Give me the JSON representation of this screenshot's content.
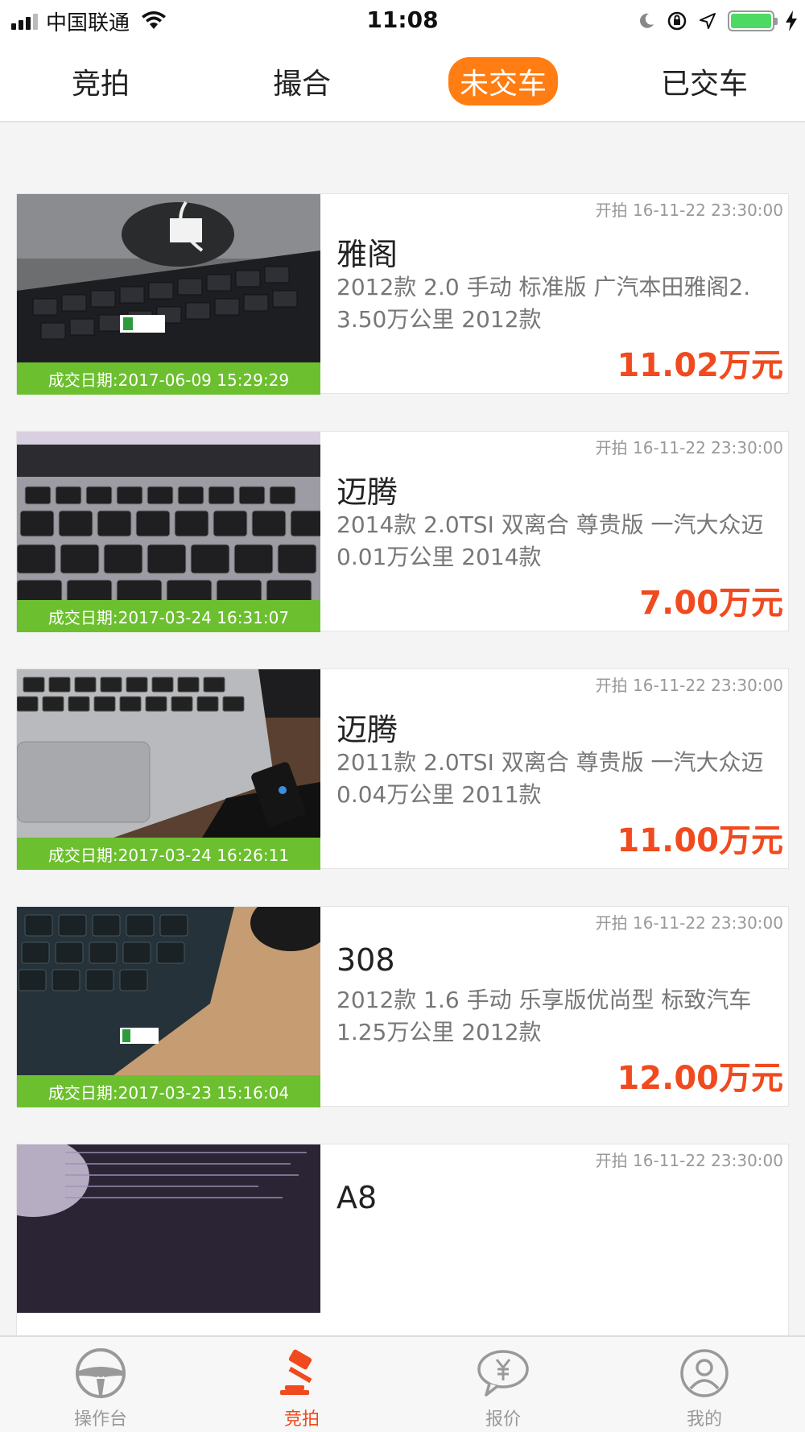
{
  "status_bar": {
    "carrier": "中国联通",
    "time": "11:08"
  },
  "tabs": [
    {
      "label": "竞拍",
      "active": false
    },
    {
      "label": "撮合",
      "active": false
    },
    {
      "label": "未交车",
      "active": true
    },
    {
      "label": "已交车",
      "active": false
    }
  ],
  "listings": [
    {
      "name": "雅阁",
      "desc": "2012款 2.0 手动 标准版 广汽本田雅阁2.",
      "km": "3.50万公里 2012款",
      "price": "11.02万元",
      "start": "开拍 16-11-22 23:30:00",
      "deal_date": "成交日期:2017-06-09 15:29:29"
    },
    {
      "name": "迈腾",
      "desc": "2014款 2.0TSI 双离合 尊贵版 一汽大众迈",
      "km": "0.01万公里 2014款",
      "price": "7.00万元",
      "start": "开拍 16-11-22 23:30:00",
      "deal_date": "成交日期:2017-03-24 16:31:07"
    },
    {
      "name": "迈腾",
      "desc": "2011款 2.0TSI 双离合 尊贵版 一汽大众迈",
      "km": "0.04万公里 2011款",
      "price": "11.00万元",
      "start": "开拍 16-11-22 23:30:00",
      "deal_date": "成交日期:2017-03-24 16:26:11"
    },
    {
      "name": "308",
      "desc": "2012款 1.6 手动 乐享版优尚型 标致汽车",
      "km": "1.25万公里 2012款",
      "price": "12.00万元",
      "start": "开拍 16-11-22 23:30:00",
      "deal_date": "成交日期:2017-03-23 15:16:04"
    },
    {
      "name": "A8",
      "desc": "",
      "km": "",
      "price": "",
      "start": "开拍 16-11-22 23:30:00",
      "deal_date": ""
    }
  ],
  "tabbar": [
    {
      "label": "操作台",
      "icon": "steering-wheel-icon",
      "active": false
    },
    {
      "label": "竞拍",
      "icon": "gavel-icon",
      "active": true
    },
    {
      "label": "报价",
      "icon": "price-bubble-icon",
      "active": false
    },
    {
      "label": "我的",
      "icon": "user-icon",
      "active": false
    }
  ],
  "colors": {
    "accent": "#ff7d12",
    "price": "#f04a1e",
    "deal_banner": "#6cbf2e"
  }
}
